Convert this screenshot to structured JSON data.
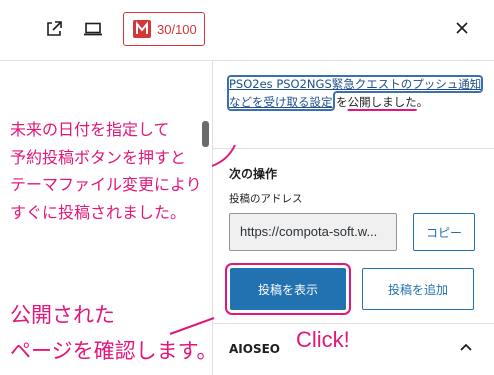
{
  "toolbar": {
    "view_post_icon": "external-link-icon",
    "preview_icon": "desktop-preview-icon",
    "seo_score": "30/100",
    "close_icon": "close-icon"
  },
  "notice": {
    "post_title": "PSO2es PSO2NGS緊急クエストのプッシュ通知などを受け取る設定",
    "text_before": " を",
    "publish_word": "公開しました",
    "text_after": "。"
  },
  "next_actions": {
    "title": "次の操作",
    "address_label": "投稿のアドレス",
    "address_value": "https://compota-soft.w...",
    "copy_label": "コピー",
    "view_post_label": "投稿を表示",
    "add_post_label": "投稿を追加"
  },
  "aioseo": {
    "title": "AIOSEO"
  },
  "annotations": {
    "note_top": "未来の日付を指定して\n予約投稿ボタンを押すと\nテーマファイル変更により\nすぐに投稿されました。",
    "note_bottom": "公開された\nページを確認します。",
    "click": "Click!",
    "color": "#e3177a"
  },
  "colors": {
    "accent": "#2271b1",
    "seo_badge": "#d63638"
  }
}
